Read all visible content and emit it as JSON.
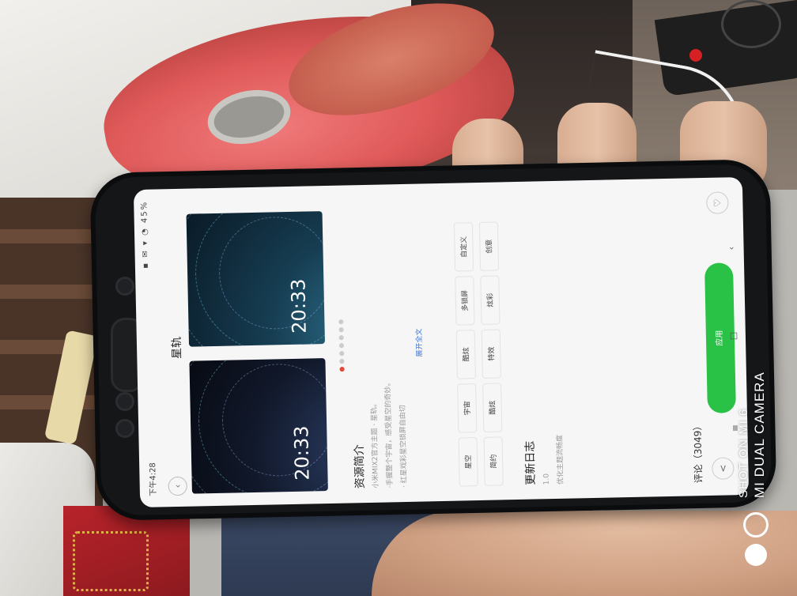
{
  "phone_screen": {
    "status": {
      "time": "下午4:28",
      "icons": "▪ ✉ ▾ ◔ 45%"
    },
    "header": {
      "back_icon": "‹",
      "title": "星轨"
    },
    "preview": {
      "clock_1": "20:33",
      "clock_2": "20:33"
    },
    "intro": {
      "heading": "资源简介",
      "line1": "小米MIX2官方主题 · 星轨。",
      "line2": "·手握整个宇宙，感受星空的奇妙。",
      "line3": "· 红星戏彩星空锁屏自由切",
      "expand": "展开全文"
    },
    "tags": [
      "星空",
      "宇宙",
      "酷炫",
      "多锁屏",
      "自定义",
      "简约",
      "酷炫",
      "特效",
      "炫彩",
      "创意"
    ],
    "changelog": {
      "heading": "更新日志",
      "version": "1.0",
      "note": "优化主题流畅度"
    },
    "comments": "评论（3049）",
    "apply_button": "应用",
    "share_icon": "<",
    "favorite_icon": "♡",
    "sys_nav": {
      "menu": "≡",
      "home": "□",
      "back": "‹",
      "extra": "‹"
    }
  },
  "watermark": {
    "line1": "SHOT ON MI 6",
    "line2": "MI DUAL CAMERA"
  }
}
